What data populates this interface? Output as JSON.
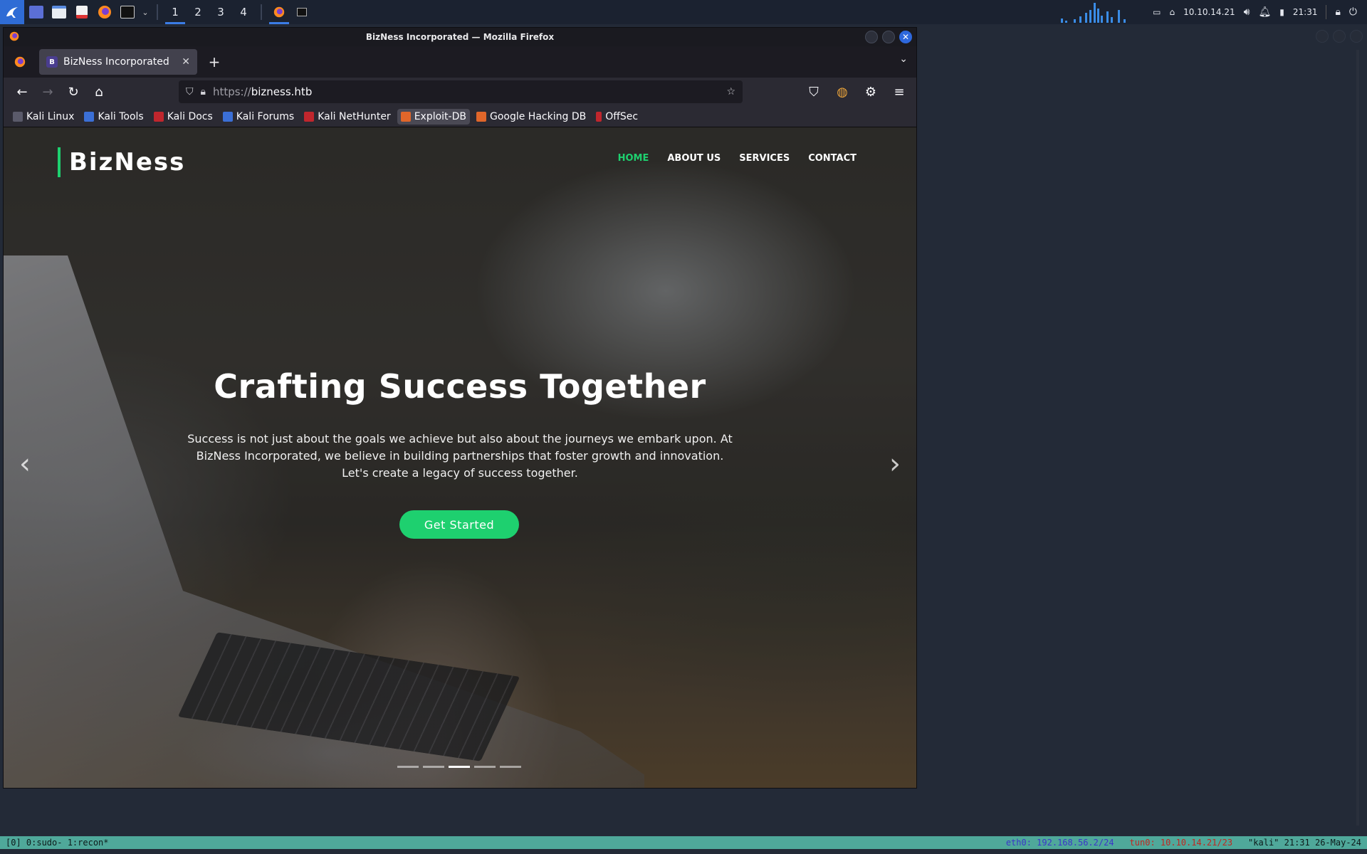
{
  "panel": {
    "workspaces": [
      "1",
      "2",
      "3",
      "4"
    ],
    "active_workspace": "1",
    "ip": "10.10.14.21",
    "clock": "21:31"
  },
  "window": {
    "title": "BizNess Incorporated — Mozilla Firefox"
  },
  "tab": {
    "favicon_letter": "B",
    "title": "BizNess Incorporated"
  },
  "urlbar": {
    "scheme": "https://",
    "host": "bizness.htb"
  },
  "bookmarks": [
    {
      "label": "Kali Linux",
      "color": "#5a5a6a"
    },
    {
      "label": "Kali Tools",
      "color": "#3b6fd6"
    },
    {
      "label": "Kali Docs",
      "color": "#c0262d"
    },
    {
      "label": "Kali Forums",
      "color": "#3b6fd6"
    },
    {
      "label": "Kali NetHunter",
      "color": "#c0262d"
    },
    {
      "label": "Exploit-DB",
      "color": "#e0662a"
    },
    {
      "label": "Google Hacking DB",
      "color": "#e0662a"
    },
    {
      "label": "OffSec",
      "color": "#c0262d"
    }
  ],
  "site": {
    "logo": "BizNess",
    "nav": [
      "HOME",
      "ABOUT US",
      "SERVICES",
      "CONTACT"
    ],
    "active_nav": "HOME",
    "accent_color": "#1ed06f",
    "hero_title": "Crafting Success Together",
    "hero_text": "Success is not just about the goals we achieve but also about the journeys we embark upon. At BizNess Incorporated, we believe in building partnerships that foster growth and innovation. Let's create a legacy of success together.",
    "cta_label": "Get Started",
    "carousel_slides": 5,
    "carousel_active": 3
  },
  "tmux": {
    "left": "[0] 0:sudo- 1:recon*",
    "eth": "eth0: 192.168.56.2/24",
    "tun": "tun0: 10.10.14.21/23",
    "host_time": "\"kali\" 21:31 26-May-24"
  }
}
